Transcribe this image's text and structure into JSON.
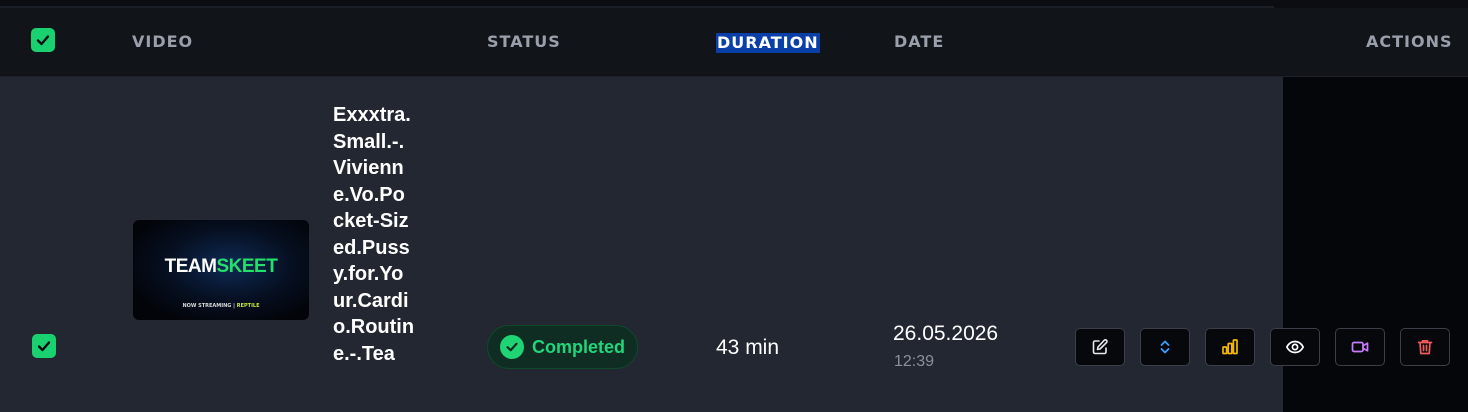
{
  "header": {
    "video": "VIDEO",
    "status": "STATUS",
    "duration": "DURATION",
    "date": "DATE",
    "actions": "ACTIONS"
  },
  "row": {
    "thumbnail": {
      "brand_left": "TEAM",
      "brand_right": "SKEET",
      "streaming_prefix": "NOW STREAMING",
      "streaming_sep": "|",
      "streaming_highlight": "REPTILE"
    },
    "title": "Exxxtra.Small.-.Vivienne.Vo.Pocket-Sized.Pussy.for.Your.Cardio.Routine.-.Tea",
    "status": "Completed",
    "duration": "43 min",
    "date": "26.05.2026",
    "time": "12:39",
    "actions": [
      "edit-icon",
      "sort-icon",
      "stats-icon",
      "view-icon",
      "video-icon",
      "delete-icon"
    ]
  },
  "colors": {
    "accent_green": "#19d16f",
    "status_green": "#22d47a",
    "stats_yellow": "#f5b800",
    "sort_blue": "#3aa0ff",
    "video_purple": "#c77dff",
    "delete_red": "#f05b5b",
    "selection_blue": "#0a3fa8"
  }
}
